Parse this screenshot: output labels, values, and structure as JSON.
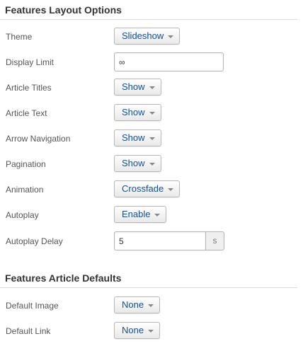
{
  "layout_section": {
    "heading": "Features Layout Options",
    "fields": {
      "theme": {
        "label": "Theme",
        "value": "Slideshow"
      },
      "display_limit": {
        "label": "Display Limit",
        "value": "∞"
      },
      "article_titles": {
        "label": "Article Titles",
        "value": "Show"
      },
      "article_text": {
        "label": "Article Text",
        "value": "Show"
      },
      "arrow_navigation": {
        "label": "Arrow Navigation",
        "value": "Show"
      },
      "pagination": {
        "label": "Pagination",
        "value": "Show"
      },
      "animation": {
        "label": "Animation",
        "value": "Crossfade"
      },
      "autoplay": {
        "label": "Autoplay",
        "value": "Enable"
      },
      "autoplay_delay": {
        "label": "Autoplay Delay",
        "value": "5",
        "unit": "s"
      }
    }
  },
  "defaults_section": {
    "heading": "Features Article Defaults",
    "fields": {
      "default_image": {
        "label": "Default Image",
        "value": "None"
      },
      "default_link": {
        "label": "Default Link",
        "value": "None"
      }
    }
  },
  "icons": {
    "dropdown": "chevron-down-icon"
  },
  "colors": {
    "dropdown_text": "#1a4f8a",
    "label_text": "#555555",
    "heading_text": "#333333",
    "rule": "#dcdcdc"
  }
}
